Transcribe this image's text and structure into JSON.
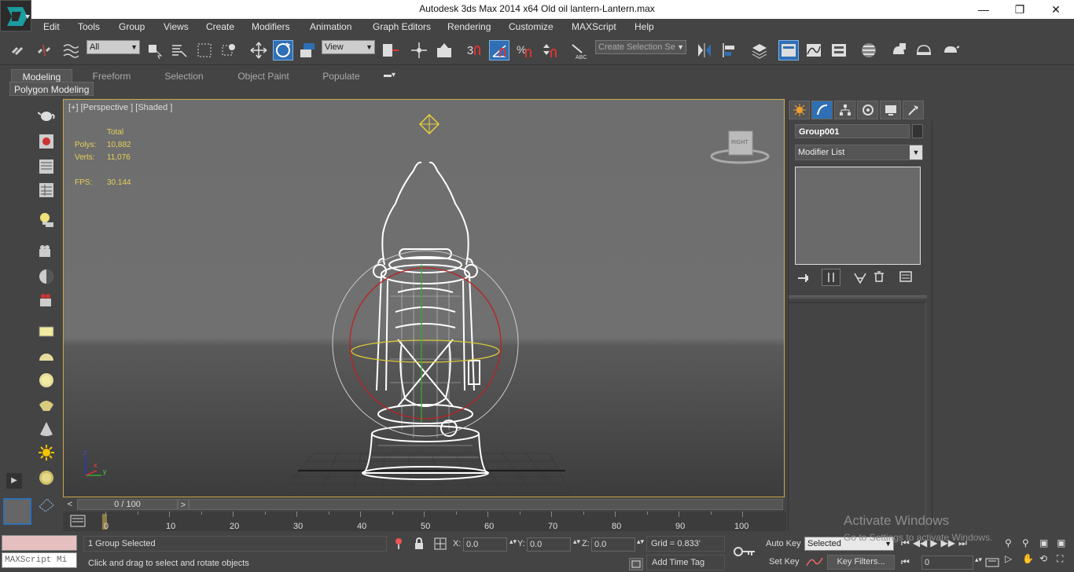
{
  "window": {
    "title": "Autodesk 3ds Max  2014 x64     Old oil lantern-Lantern.max",
    "minimize": "—",
    "restore": "❐",
    "close": "✕"
  },
  "menu": [
    "Edit",
    "Tools",
    "Group",
    "Views",
    "Create",
    "Modifiers",
    "Animation",
    "Graph Editors",
    "Rendering",
    "Customize",
    "MAXScript",
    "Help"
  ],
  "toolbar": {
    "selection_filter": "All",
    "ref_coord": "View",
    "named_selection_placeholder": "Create Selection Se",
    "snap_label": "3",
    "active_tool": "rotate"
  },
  "ribbon": {
    "tabs": [
      "Modeling",
      "Freeform",
      "Selection",
      "Object Paint",
      "Populate"
    ],
    "active": "Modeling",
    "panel": "Polygon Modeling"
  },
  "viewport": {
    "label": "[+] [Perspective ] [Shaded ]",
    "stats": {
      "header": "Total",
      "polys_label": "Polys:",
      "polys": "10,882",
      "verts_label": "Verts:",
      "verts": "11,076",
      "fps_label": "FPS:",
      "fps": "30.144"
    },
    "viewcube_label": "RIGHT",
    "axis_z": "z",
    "axis_x": "x",
    "axis_y": "y"
  },
  "command_panel": {
    "object_name": "Group001",
    "modifier_list": "Modifier List"
  },
  "timeline": {
    "frame_display": "0 / 100",
    "prev": "<",
    "next": ">",
    "ticks": [
      "0",
      "10",
      "20",
      "30",
      "40",
      "50",
      "60",
      "70",
      "80",
      "90",
      "100"
    ]
  },
  "status": {
    "maxscript": "MAXScript Mi",
    "selected": "1 Group Selected",
    "prompt": "Click and drag to select and rotate objects",
    "x_label": "X:",
    "x": "0.0",
    "y_label": "Y:",
    "y": "0.0",
    "z_label": "Z:",
    "z": "0.0",
    "grid": "Grid = 0.833'",
    "add_time_tag": "Add Time Tag",
    "auto_key": "Auto Key",
    "set_key": "Set Key",
    "key_mode": "Selected",
    "key_filters": "Key Filters...",
    "frame": "0",
    "watermark_title": "Activate Windows",
    "watermark_sub": "Go to Settings to activate Windows."
  },
  "colors": {
    "accent": "#2f6fb5",
    "viewport_border": "#c9a84c",
    "stats": "#e4d05a"
  }
}
